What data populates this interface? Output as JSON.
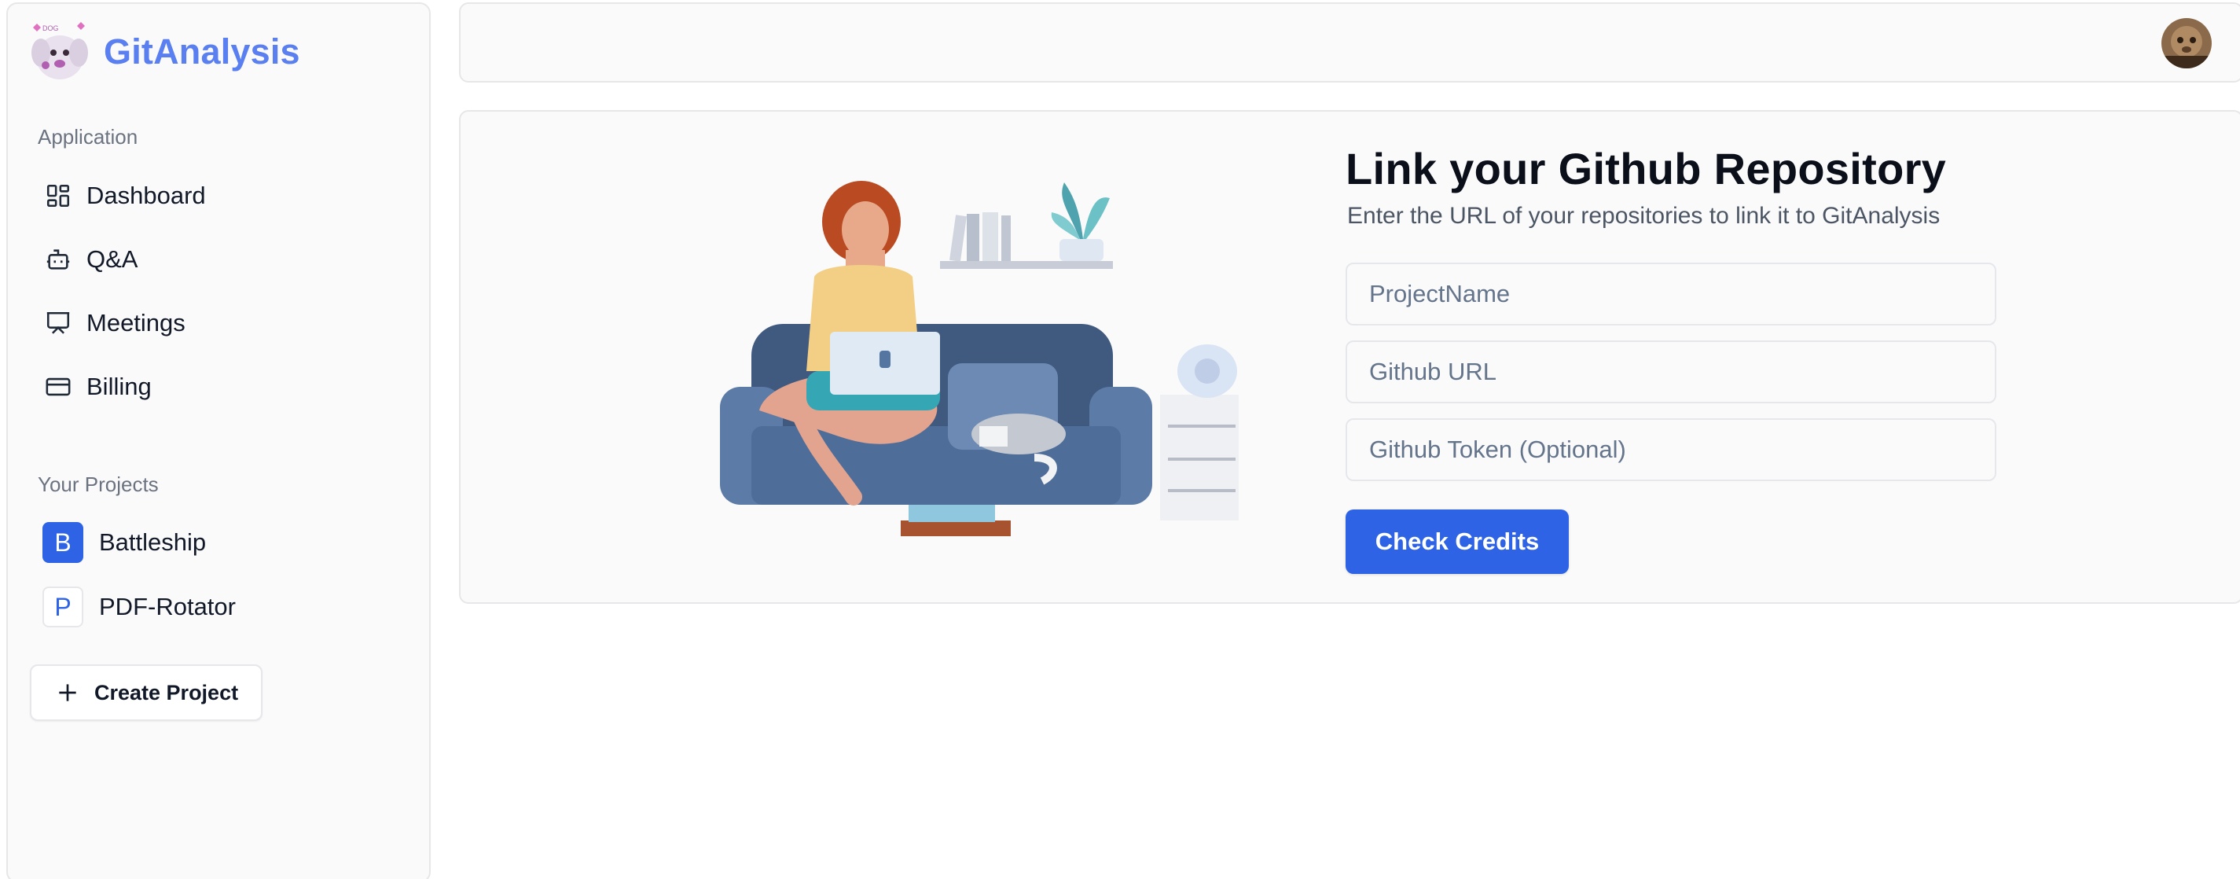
{
  "app": {
    "name": "GitAnalysis",
    "logo_icon": "dog-logo-icon"
  },
  "sidebar": {
    "application_label": "Application",
    "nav_items": [
      {
        "label": "Dashboard",
        "icon": "dashboard-icon"
      },
      {
        "label": "Q&A",
        "icon": "bot-icon"
      },
      {
        "label": "Meetings",
        "icon": "presentation-icon"
      },
      {
        "label": "Billing",
        "icon": "credit-card-icon"
      }
    ],
    "projects_label": "Your Projects",
    "projects": [
      {
        "initial": "B",
        "name": "Battleship",
        "active": true
      },
      {
        "initial": "P",
        "name": "PDF-Rotator",
        "active": false
      }
    ],
    "create_project_label": "Create Project"
  },
  "header": {
    "avatar_icon": "user-avatar"
  },
  "main": {
    "title": "Link your Github Repository",
    "subtitle": "Enter the URL of your repositories to link it to GitAnalysis",
    "fields": {
      "project_name_placeholder": "ProjectName",
      "github_url_placeholder": "Github URL",
      "github_token_placeholder": "Github Token (Optional)"
    },
    "submit_label": "Check Credits"
  },
  "colors": {
    "brand": "#5a7ff0",
    "primary": "#2f63e6"
  }
}
